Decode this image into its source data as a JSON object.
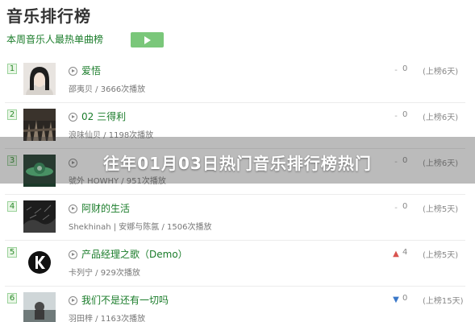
{
  "header": {
    "title": "音乐排行榜",
    "subtitle": "本周音乐人最热单曲榜"
  },
  "overlay": {
    "title": "往年01月03日热门音乐排行榜热门"
  },
  "songs": [
    {
      "rank": "1",
      "title": "爱悟",
      "artist_plays": "邵夷贝 / 3666次播放",
      "trend": "neutral",
      "change": "0",
      "weeks": "(上榜6天)"
    },
    {
      "rank": "2",
      "title": "02 三得利",
      "artist_plays": "浪味仙贝 / 1198次播放",
      "trend": "neutral",
      "change": "0",
      "weeks": "(上榜6天)"
    },
    {
      "rank": "3",
      "title": "",
      "artist_plays": "號外 HOWHY / 951次播放",
      "trend": "neutral",
      "change": "0",
      "weeks": "(上榜6天)"
    },
    {
      "rank": "4",
      "title": "阿财的生活",
      "artist_plays": "Shekhinah | 安娜与陈氤 / 1506次播放",
      "trend": "neutral",
      "change": "0",
      "weeks": "(上榜5天)"
    },
    {
      "rank": "5",
      "title": "产品经理之歌（Demo）",
      "artist_plays": "卡列宁 / 929次播放",
      "trend": "up",
      "change": "4",
      "weeks": "(上榜5天)"
    },
    {
      "rank": "6",
      "title": "我们不是还有一切吗",
      "artist_plays": "羽田梓 / 1163次播放",
      "trend": "down",
      "change": "0",
      "weeks": "(上榜15天)"
    }
  ],
  "colors": {
    "accent_green": "#1a7c2a",
    "button_green": "#7ac77a",
    "trend_up": "#d9534f",
    "trend_down": "#3a78c9",
    "trend_neutral": "#aaaaaa"
  },
  "icons": {
    "play_all": "play-icon",
    "song_play": "play-circle-icon",
    "cover_5": "k-logo-icon"
  }
}
